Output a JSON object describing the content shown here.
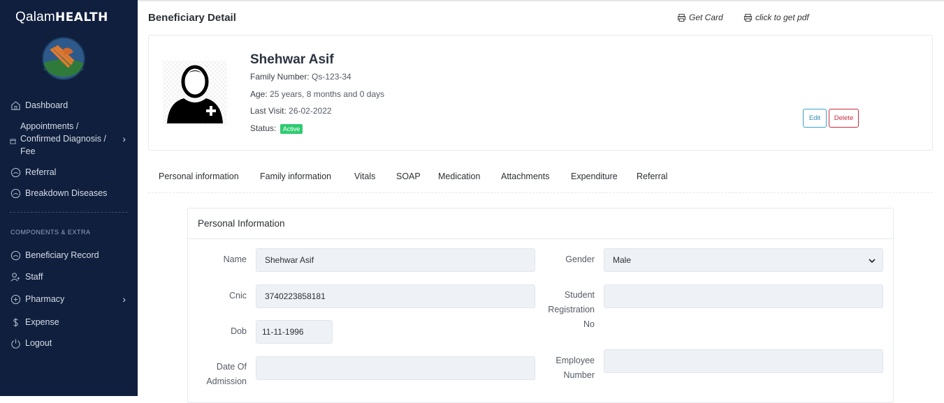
{
  "sidebar": {
    "brand_prefix": "Qalam",
    "brand_suffix": "HEALTH",
    "items": [
      {
        "label": "Dashboard"
      },
      {
        "label": "Appointments / Confirmed Diagnosis / Fee"
      },
      {
        "label": "Referral"
      },
      {
        "label": "Breakdown Diseases"
      }
    ],
    "section_label": "COMPONENTS & EXTRA",
    "items2": [
      {
        "label": "Beneficiary Record"
      },
      {
        "label": "Staff"
      },
      {
        "label": "Pharmacy"
      },
      {
        "label": "Expense"
      },
      {
        "label": "Logout"
      }
    ]
  },
  "header": {
    "title": "Beneficiary Detail",
    "get_card": "Get Card",
    "get_pdf": "click to get pdf"
  },
  "profile": {
    "name": "Shehwar Asif",
    "family_number_label": "Family Number:",
    "family_number": "Qs-123-34",
    "age_label": "Age:",
    "age": "25 years, 8 months and 0 days",
    "last_visit_label": "Last Visit:",
    "last_visit": "26-02-2022",
    "status_label": "Status:",
    "status": "Active",
    "edit_label": "Edit",
    "delete_label": "Delete"
  },
  "tabs": [
    {
      "label": "Personal information"
    },
    {
      "label": "Family information"
    },
    {
      "label": "Vitals"
    },
    {
      "label": "SOAP"
    },
    {
      "label": "Medication"
    },
    {
      "label": "Attachments"
    },
    {
      "label": "Expenditure"
    },
    {
      "label": "Referral"
    }
  ],
  "personal": {
    "heading": "Personal Information",
    "name_label": "Name",
    "name_value": "Shehwar Asif",
    "gender_label": "Gender",
    "gender_value": "Male",
    "cnic_label": "Cnic",
    "cnic_value": "3740223858181",
    "student_reg_label_1": "Student",
    "student_reg_label_2": "Registration",
    "student_reg_label_3": "No",
    "student_reg_value": "",
    "dob_label": "Dob",
    "dob_value": "11-11-1996",
    "admission_label_1": "Date Of",
    "admission_label_2": "Admission",
    "admission_value": "",
    "employee_label_1": "Employee",
    "employee_label_2": "Number",
    "employee_value": ""
  },
  "colors": {
    "sidebar_bg": "#0f1f3d",
    "active_badge": "#2ecc71",
    "edit_border": "#3aa0c8",
    "delete_border": "#c72b3f"
  }
}
